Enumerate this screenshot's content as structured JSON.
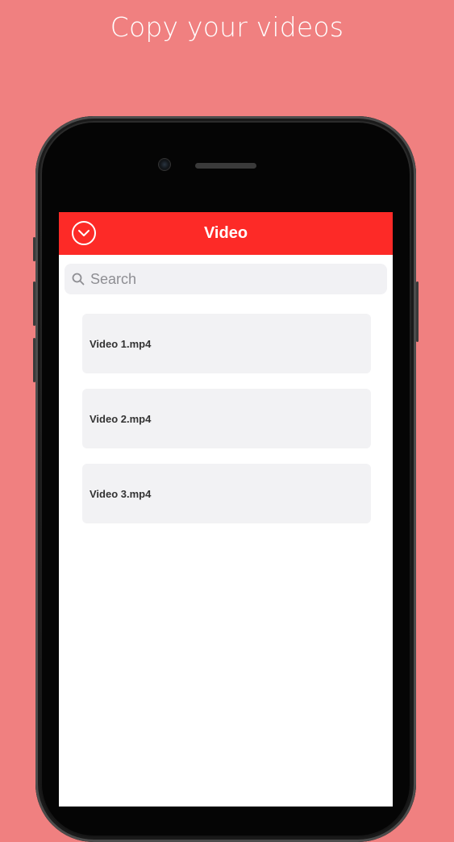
{
  "caption": "Copy your videos",
  "navbar": {
    "title": "Video",
    "back_icon": "chevron-down-circle-icon"
  },
  "search": {
    "placeholder": "Search",
    "value": "",
    "icon": "search-icon"
  },
  "videos": [
    {
      "name": "Video 1.mp4"
    },
    {
      "name": "Video 2.mp4"
    },
    {
      "name": "Video 3.mp4"
    }
  ],
  "colors": {
    "background": "#f08080",
    "navbar": "#fd2a27",
    "item_background": "#f2f2f4",
    "search_background": "#f1f1f4"
  }
}
